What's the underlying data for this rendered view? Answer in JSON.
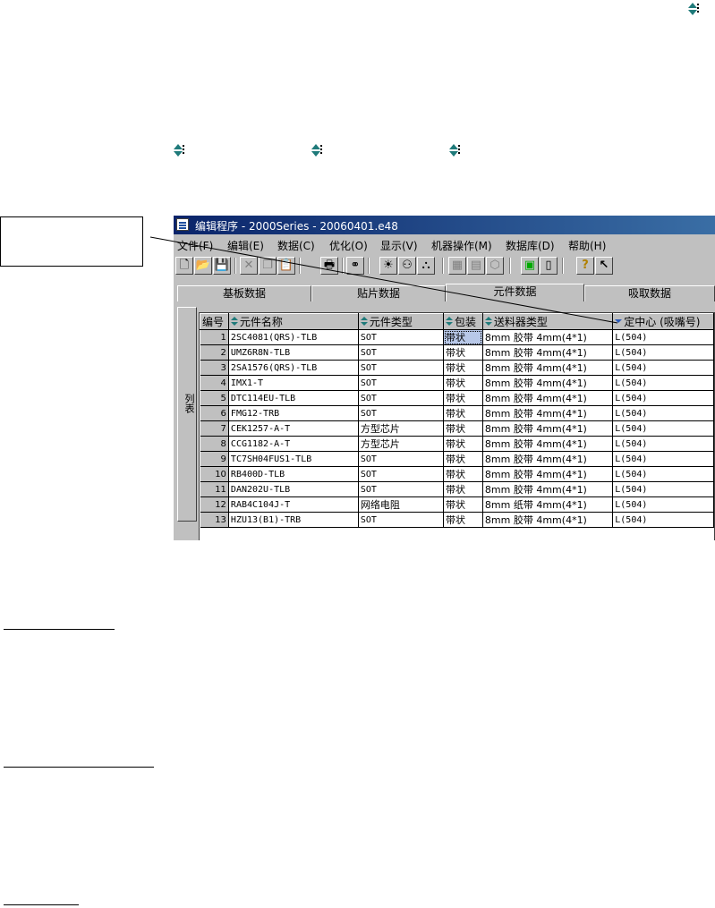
{
  "window": {
    "title": "编辑程序 - 2000Series - 20060401.e48",
    "menu": [
      "文件(F)",
      "编辑(E)",
      "数据(C)",
      "优化(O)",
      "显示(V)",
      "机器操作(M)",
      "数据库(D)",
      "帮助(H)"
    ],
    "toolbar_icons": [
      "new-file-icon",
      "open-folder-icon",
      "save-icon",
      "cut-icon",
      "copy-icon",
      "paste-icon",
      "print-icon",
      "find-icon",
      "lightbulb-icon",
      "check-icon",
      "components-icon",
      "machine-icon",
      "feeder-icon",
      "box-icon",
      "grid-icon",
      "panel-icon",
      "help-icon",
      "context-help-icon"
    ],
    "tabs": [
      "基板数据",
      "贴片数据",
      "元件数据",
      "吸取数据"
    ],
    "active_tab": "元件数据",
    "side_tab": "列表"
  },
  "grid": {
    "columns": [
      "编号",
      "元件名称",
      "元件类型",
      "包装",
      "送料器类型",
      "定中心 (吸嘴号)"
    ],
    "rows": [
      {
        "no": "1",
        "name": "2SC4081(QRS)-TLB",
        "type": "SOT",
        "pack": "带状",
        "feeder": "8mm 胶带  4mm(4*1)",
        "center": "L(504)"
      },
      {
        "no": "2",
        "name": "UMZ6R8N-TLB",
        "type": "SOT",
        "pack": "带状",
        "feeder": "8mm 胶带  4mm(4*1)",
        "center": "L(504)"
      },
      {
        "no": "3",
        "name": "2SA1576(QRS)-TLB",
        "type": "SOT",
        "pack": "带状",
        "feeder": "8mm 胶带  4mm(4*1)",
        "center": "L(504)"
      },
      {
        "no": "4",
        "name": "IMX1-T",
        "type": "SOT",
        "pack": "带状",
        "feeder": "8mm 胶带  4mm(4*1)",
        "center": "L(504)"
      },
      {
        "no": "5",
        "name": "DTC114EU-TLB",
        "type": "SOT",
        "pack": "带状",
        "feeder": "8mm 胶带  4mm(4*1)",
        "center": "L(504)"
      },
      {
        "no": "6",
        "name": "FMG12-TRB",
        "type": "SOT",
        "pack": "带状",
        "feeder": "8mm 胶带  4mm(4*1)",
        "center": "L(504)"
      },
      {
        "no": "7",
        "name": "CEK1257-A-T",
        "type": "方型芯片",
        "pack": "带状",
        "feeder": "8mm 胶带  4mm(4*1)",
        "center": "L(504)"
      },
      {
        "no": "8",
        "name": "CCG1182-A-T",
        "type": "方型芯片",
        "pack": "带状",
        "feeder": "8mm 胶带  4mm(4*1)",
        "center": "L(504)"
      },
      {
        "no": "9",
        "name": "TC7SH04FUS1-TLB",
        "type": "SOT",
        "pack": "带状",
        "feeder": "8mm 胶带  4mm(4*1)",
        "center": "L(504)"
      },
      {
        "no": "10",
        "name": "RB400D-TLB",
        "type": "SOT",
        "pack": "带状",
        "feeder": "8mm 胶带  4mm(4*1)",
        "center": "L(504)"
      },
      {
        "no": "11",
        "name": "DAN202U-TLB",
        "type": "SOT",
        "pack": "带状",
        "feeder": "8mm 胶带  4mm(4*1)",
        "center": "L(504)"
      },
      {
        "no": "12",
        "name": "RAB4C104J-T",
        "type": "网络电阻",
        "pack": "带状",
        "feeder": "8mm 纸带  4mm(4*1)",
        "center": "L(504)"
      },
      {
        "no": "13",
        "name": "HZU13(B1)-TRB",
        "type": "SOT",
        "pack": "带状",
        "feeder": "8mm 胶带  4mm(4*1)",
        "center": "L(504)"
      }
    ]
  }
}
